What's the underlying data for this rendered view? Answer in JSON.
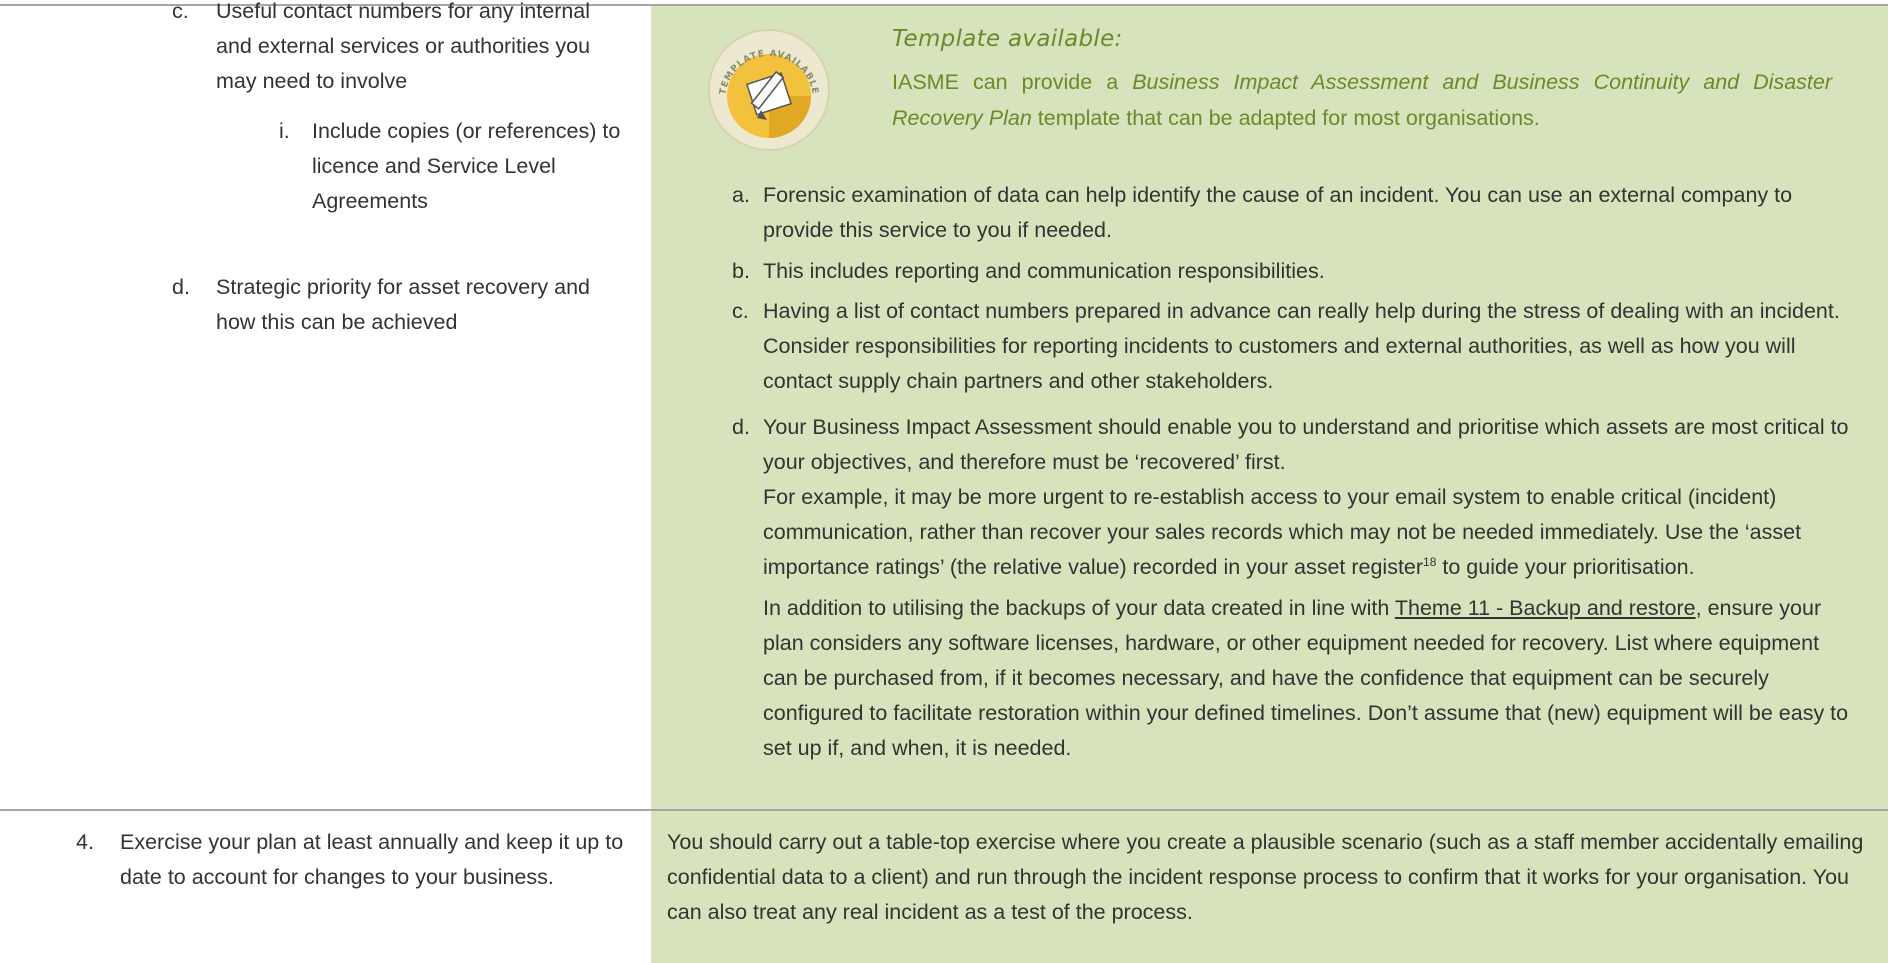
{
  "left": {
    "item_c": {
      "label": "c.",
      "text": "Useful contact numbers for any internal and external services or authorities you may need to involve"
    },
    "item_c_i": {
      "label": "i.",
      "text": "Include copies (or references) to licence and Service Level Agreements"
    },
    "item_d": {
      "label": "d.",
      "text": "Strategic priority for asset recovery and how this can be achieved"
    },
    "item_4": {
      "label": "4.",
      "text": "Exercise your plan at least annually and keep it up to date to account for changes to your business."
    }
  },
  "template_note": {
    "badge_text": "TEMPLATE AVAILABLE",
    "title": "Template available:",
    "body_prefix": "IASME can provide a ",
    "body_emphasis": "Business Impact Assessment and Business Continuity and Disaster Recovery Plan",
    "body_suffix": " template that can be adapted for most organisations."
  },
  "right": {
    "item_a": {
      "label": "a.",
      "text": "Forensic examination of data can help identify the cause of an incident. You can use an external company to provide this service to you if needed."
    },
    "item_b": {
      "label": "b.",
      "text": "This includes reporting and communication responsibilities."
    },
    "item_c": {
      "label": "c.",
      "text": "Having a list of contact numbers prepared in advance can really help during the stress of dealing with an incident. Consider responsibilities for reporting incidents to customers and external authorities, as well as how you will contact supply chain partners and other stakeholders."
    },
    "item_d": {
      "label": "d.",
      "p1": "Your Business Impact Assessment should enable you to understand and prioritise which assets are most critical to your objectives, and therefore must be ‘recovered’ first.",
      "p2": " For example, it may be more urgent to re-establish access to your email system to enable critical (incident) communication, rather than recover your sales records which may not be needed immediately. Use the ‘asset importance ratings’ (the relative value) recorded in your asset register",
      "p2_footnote": "18",
      "p2_end": " to guide your prioritisation.",
      "p3_prefix": "In addition to utilising the backups of your data created in line with ",
      "p3_link": "Theme 11 - Backup and restore",
      "p3_suffix": ", ensure your plan considers any software licenses, hardware, or other equipment needed for recovery. List where equipment can be purchased from, if it becomes necessary, and have the confidence that equipment can be securely configured to facilitate restoration within your defined timelines. Don’t assume that (new) equipment will be easy to set up if, and when, it is needed."
    },
    "item_4": "You should carry out a table-top exercise where you create a plausible scenario (such as a staff member accidentally emailing confidential data to a client) and run through the incident response process to confirm that it works for your organisation. You can also treat any real incident as a test of the process."
  },
  "colors": {
    "panel_bg": "#d6e3bc",
    "template_text": "#6b8a29",
    "body_text": "#333333",
    "rule": "#a6a6a6"
  },
  "icons": {
    "template_badge": "pencil-paper-badge-icon"
  }
}
